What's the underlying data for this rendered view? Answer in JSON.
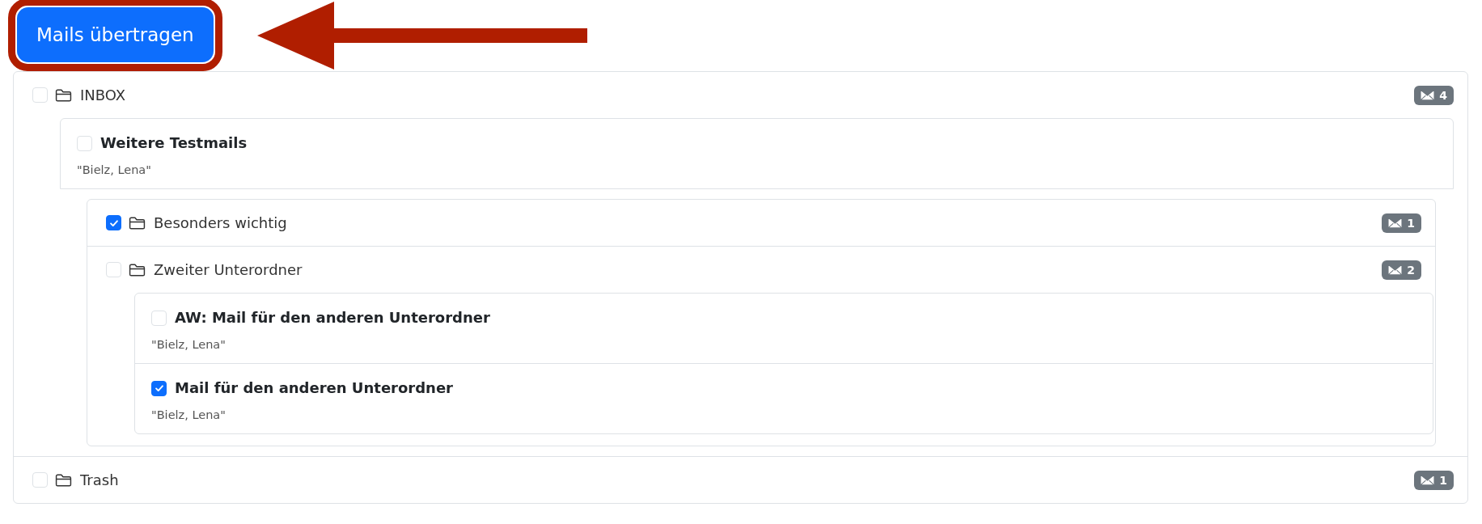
{
  "transfer_button": {
    "label": "Mails übertragen"
  },
  "folders": [
    {
      "name": "INBOX",
      "checked": false,
      "count": "4",
      "mails": [
        {
          "subject": "Weitere Testmails",
          "sender": "\"Bielz, Lena\"",
          "checked": false
        }
      ],
      "children": [
        {
          "name": "Besonders wichtig",
          "checked": true,
          "count": "1"
        },
        {
          "name": "Zweiter Unterordner",
          "checked": false,
          "count": "2",
          "mails": [
            {
              "subject": "AW: Mail für den anderen Unterordner",
              "sender": "\"Bielz, Lena\"",
              "checked": false
            },
            {
              "subject": "Mail für den anderen Unterordner",
              "sender": "\"Bielz, Lena\"",
              "checked": true
            }
          ]
        }
      ]
    },
    {
      "name": "Trash",
      "checked": false,
      "count": "1"
    }
  ]
}
